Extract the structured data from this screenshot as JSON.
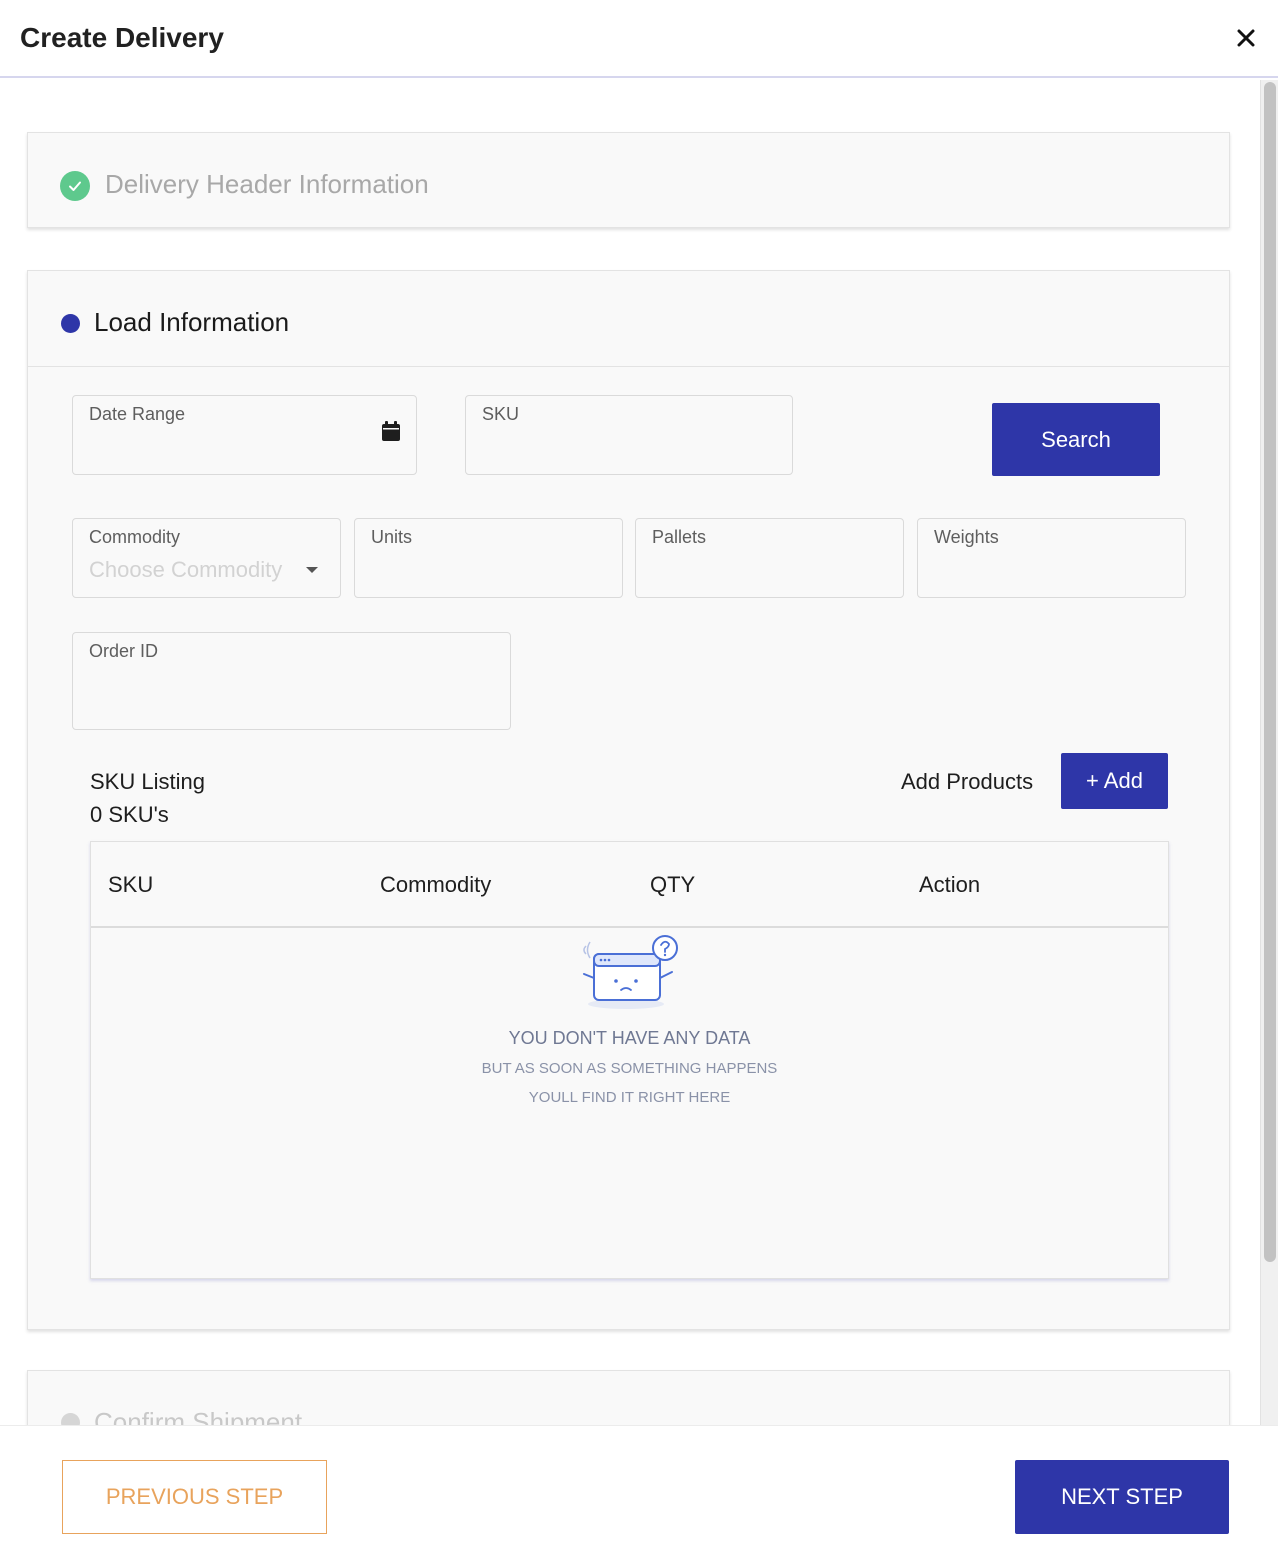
{
  "modal": {
    "title": "Create Delivery",
    "close_icon": "close-icon"
  },
  "steps": [
    {
      "title": "Delivery Header Information",
      "status": "completed"
    },
    {
      "title": "Load Information",
      "status": "active"
    },
    {
      "title": "Confirm Shipment",
      "status": "inactive"
    }
  ],
  "filters": {
    "date_range_label": "Date Range",
    "sku_label": "SKU",
    "search_button": "Search",
    "commodity_label": "Commodity",
    "commodity_placeholder": "Choose Commodity",
    "units_label": "Units",
    "pallets_label": "Pallets",
    "weights_label": "Weights",
    "order_id_label": "Order ID"
  },
  "sku_listing": {
    "title": "SKU Listing",
    "count": "0 SKU's",
    "add_products_label": "Add Products",
    "add_button": "+ Add",
    "columns": [
      "SKU",
      "Commodity",
      "QTY",
      "Action"
    ],
    "empty_title": "YOU DON'T HAVE ANY DATA",
    "empty_line1": "BUT AS SOON AS SOMETHING HAPPENS",
    "empty_line2": "YOULL FIND IT RIGHT HERE"
  },
  "footer": {
    "previous_button": "PREVIOUS STEP",
    "next_button": "NEXT STEP"
  },
  "colors": {
    "primary": "#2e36a8",
    "success": "#5ec98d",
    "outline_accent": "#e8a35c"
  }
}
